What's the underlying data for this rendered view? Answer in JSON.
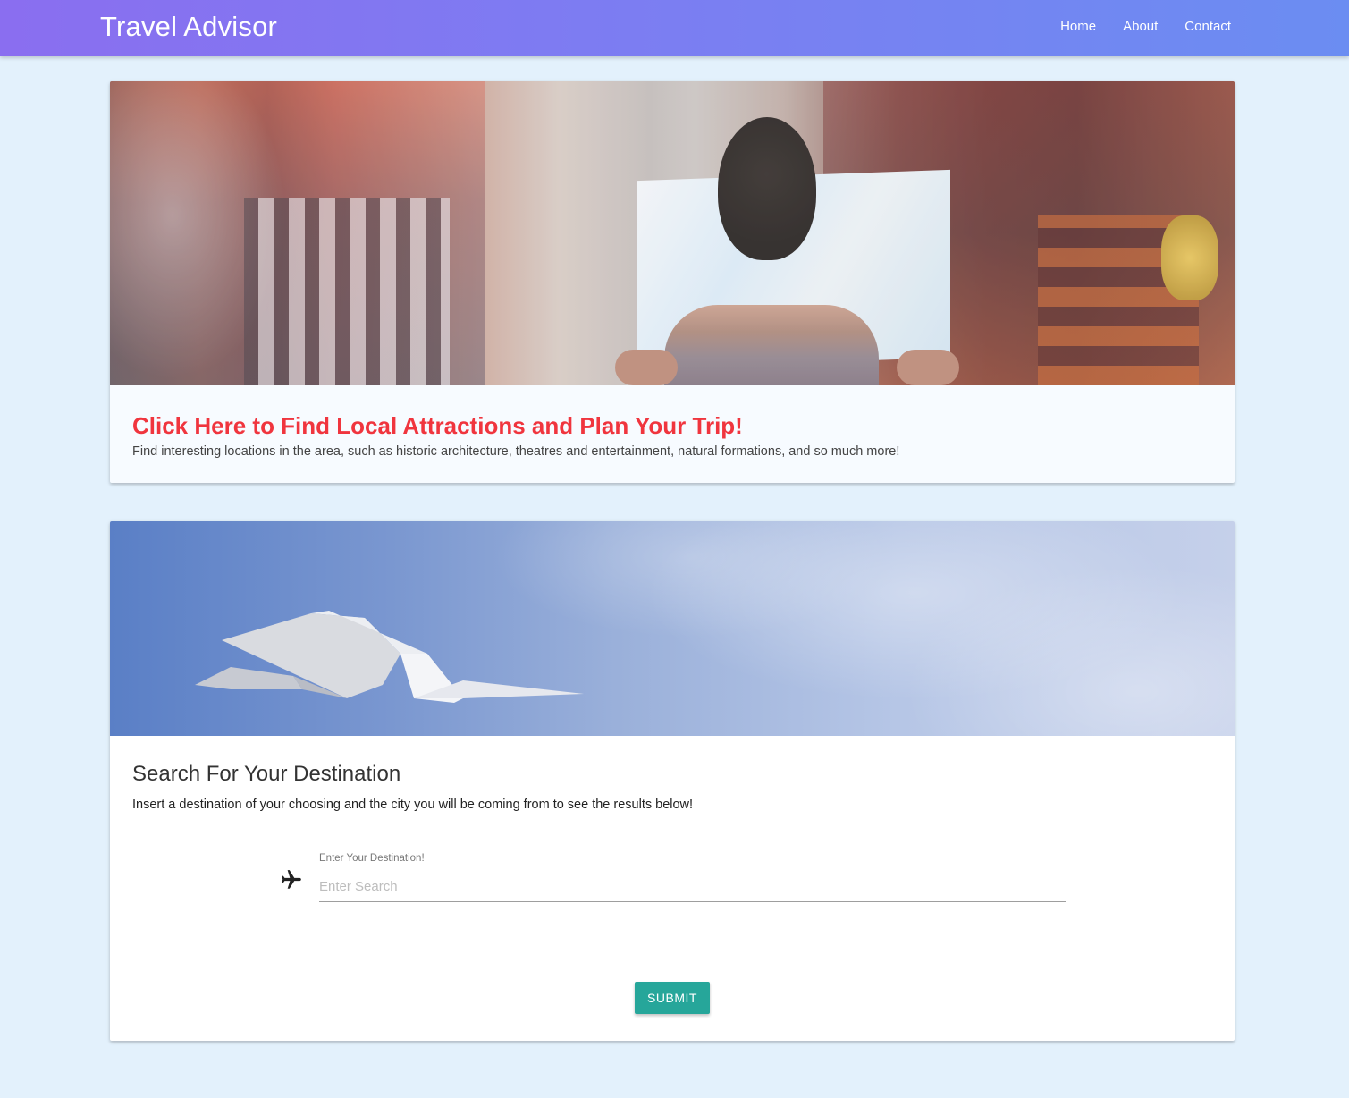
{
  "nav": {
    "brand": "Travel Advisor",
    "links": [
      "Home",
      "About",
      "Contact"
    ]
  },
  "attractions_card": {
    "title": "Click Here to Find Local Attractions and Plan Your Trip!",
    "text": "Find interesting locations in the area, such as historic architecture, theatres and entertainment, natural formations, and so much more!"
  },
  "search_card": {
    "title": "Search For Your Destination",
    "text": "Insert a destination of your choosing and the city you will be coming from to see the results below!",
    "field_label": "Enter Your Destination!",
    "placeholder": "Enter Search",
    "value": "",
    "submit_label": "SUBMIT"
  },
  "icons": {
    "search_field_icon": "airplane-icon"
  },
  "colors": {
    "navbar_gradient_start": "#8a6ef0",
    "navbar_gradient_end": "#6b8df2",
    "page_background": "#e3f1fc",
    "attraction_title": "#f0353e",
    "submit_button": "#26a69a"
  }
}
